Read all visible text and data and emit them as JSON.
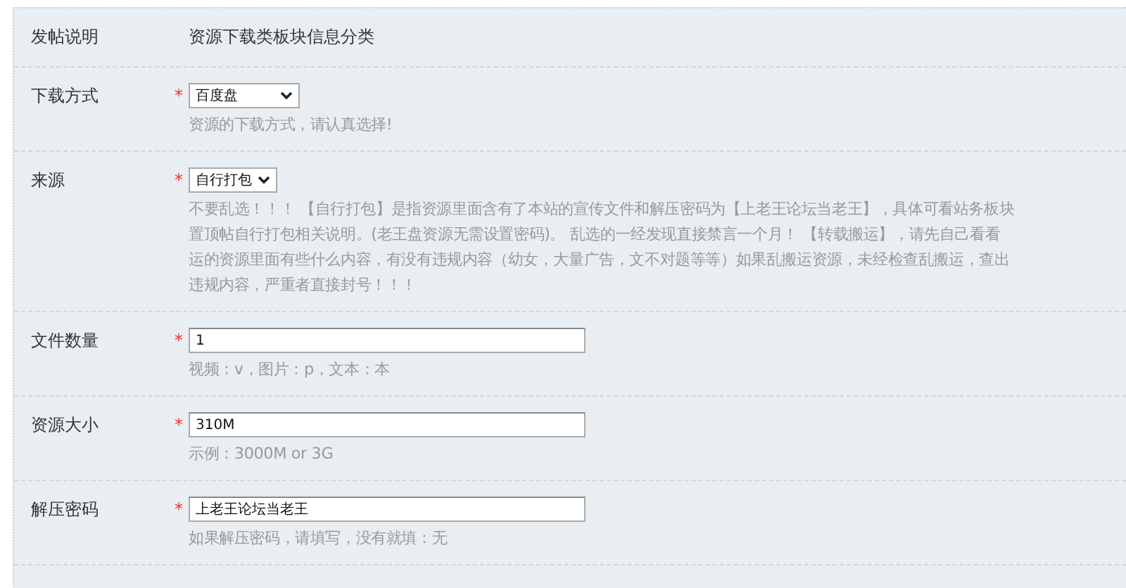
{
  "rows": [
    {
      "label": "发帖说明",
      "kind": "text",
      "value": "资源下载类板块信息分类"
    },
    {
      "label": "下载方式",
      "kind": "select",
      "marker": "*",
      "value": "百度盘",
      "hint": [
        "资源的下载方式，请认真选择!"
      ]
    },
    {
      "label": "来源",
      "kind": "select",
      "marker": "*",
      "value": "自行打包",
      "hint": [
        "不要乱选！！！ 【自行打包】是指资源里面含有了本站的宣传文件和解压密码为【上老王论坛当老王】，具体可看站务板块",
        "置顶帖自行打包相关说明。(老王盘资源无需设置密码)。 乱选的一经发现直接禁言一个月！ 【转载搬运】，请先自己看看",
        "运的资源里面有些什么内容，有没有违规内容（幼女，大量广告，文不对题等等）如果乱搬运资源，未经检查乱搬运，查出",
        "违规内容，严重者直接封号！！！"
      ]
    },
    {
      "label": "文件数量",
      "kind": "input",
      "marker": "*",
      "value": "1",
      "hint": [
        "视频：v，图片：p，文本：本"
      ]
    },
    {
      "label": "资源大小",
      "kind": "input",
      "marker": "*",
      "value": "310M",
      "hint": [
        "示例：3000M or 3G"
      ]
    },
    {
      "label": "解压密码",
      "kind": "input",
      "marker": "*",
      "value": "上老王论坛当老王",
      "hint": [
        "如果解压密码，请填写，没有就填：无"
      ]
    }
  ]
}
